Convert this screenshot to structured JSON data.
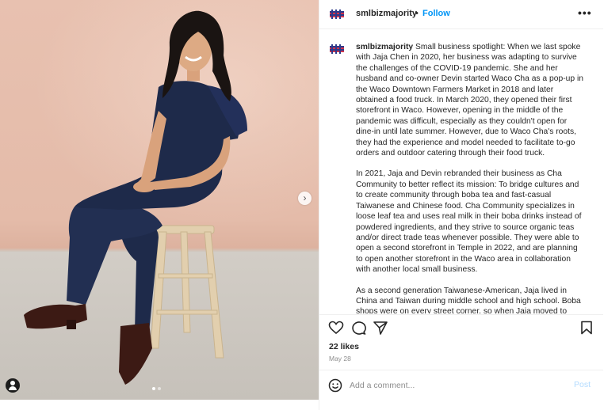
{
  "post": {
    "username": "smlbizmajority",
    "separator": "•",
    "follow_label": "Follow",
    "more_label": "•••",
    "caption": {
      "username": "smlbizmajority",
      "paragraphs": [
        "Small business spotlight: When we last spoke with Jaja Chen in 2020, her business was adapting to survive the challenges of the COVID-19 pandemic. She and her husband and co-owner Devin started Waco Cha as a pop-up in the Waco Downtown Farmers Market in 2018 and later obtained a food truck. In March 2020, they opened their first storefront in Waco. However, opening in the middle of the pandemic was difficult, especially as they couldn't open for dine-in until late summer. However, due to Waco Cha's roots, they had the experience and model needed to facilitate to-go orders and outdoor catering through their food truck.",
        "In 2021, Jaja and Devin rebranded their business as Cha Community to better reflect its mission: To bridge cultures and to create community through boba tea and fast-casual Taiwanese and Chinese food. Cha Community specializes in loose leaf tea and uses real milk in their boba drinks instead of powdered ingredients, and they strive to source organic teas and/or direct trade teas whenever possible. They were able to open a second storefront in Temple in 2022, and are planning to open another storefront in the Waco area in collaboration with another local small business.",
        "As a second generation Taiwanese-American, Jaja lived in China and Taiwan during middle school and high school. Boba shops were on every street corner, so when Jaja moved to Waco it was a \"huge culture shock.\" There wasn't access to as"
      ]
    },
    "likes": "22 likes",
    "date": "May 28",
    "comment_placeholder": "Add a comment...",
    "post_label": "Post",
    "carousel": {
      "current": 1,
      "total": 2,
      "next_icon": "chevron-right-icon"
    },
    "icons": [
      "heart-icon",
      "comment-icon",
      "share-icon",
      "bookmark-icon",
      "emoji-icon",
      "user-tag-icon"
    ],
    "colors": {
      "link": "#0095f6",
      "post_disabled": "#b3dbff",
      "muted": "#8e8e8e",
      "wall": "#e6bead",
      "outfit": "#1e2a4a"
    }
  }
}
